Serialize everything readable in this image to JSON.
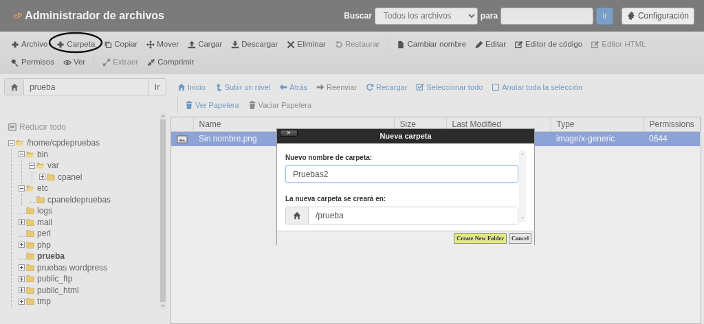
{
  "header": {
    "logo": "cP",
    "title": "Administrador de archivos",
    "search_label": "Buscar",
    "search_scope": "Todos los archivos",
    "for_label": "para",
    "go_button": "Ir",
    "settings_button": "Configuración"
  },
  "toolbar": {
    "rows": [
      {
        "groups": [
          {
            "items": [
              {
                "label": "Archivo",
                "disabled": false,
                "circled": false
              },
              {
                "label": "Carpeta",
                "disabled": false,
                "circled": true
              },
              {
                "label": "Copiar",
                "disabled": false,
                "circled": false
              },
              {
                "label": "Mover",
                "disabled": false,
                "circled": false
              },
              {
                "label": "Cargar",
                "disabled": false,
                "circled": false
              },
              {
                "label": "Descargar",
                "disabled": false,
                "circled": false
              },
              {
                "label": "Eliminar",
                "disabled": false,
                "circled": false
              },
              {
                "label": "Restaurar",
                "disabled": true,
                "circled": false
              }
            ]
          },
          {
            "items": [
              {
                "label": "Cambiar nombre",
                "disabled": false,
                "circled": false
              },
              {
                "label": "Editar",
                "disabled": false,
                "circled": false
              },
              {
                "label": "Editor de código",
                "disabled": false,
                "circled": false
              },
              {
                "label": "Editor HTML",
                "disabled": true,
                "circled": false
              }
            ]
          }
        ]
      },
      {
        "groups": [
          {
            "items": [
              {
                "label": "Permisos",
                "disabled": false,
                "circled": false
              },
              {
                "label": "Ver",
                "disabled": false,
                "circled": false
              }
            ]
          },
          {
            "items": [
              {
                "label": "Extraer",
                "disabled": true,
                "circled": false
              },
              {
                "label": "Comprimir",
                "disabled": false,
                "circled": false
              }
            ]
          }
        ]
      }
    ]
  },
  "path_bar": {
    "value": "prueba",
    "go_button": "Ir"
  },
  "tree": {
    "collapse_all": "Reducir todo",
    "nodes": [
      {
        "label": "/home/cpdepruebas",
        "kind": "branch",
        "expanded": true,
        "selected": false,
        "children": [
          {
            "label": "bin",
            "kind": "branch",
            "expanded": true,
            "selected": false,
            "children": [
              {
                "label": "var",
                "kind": "branch",
                "expanded": true,
                "selected": false,
                "children": [
                  {
                    "label": "cpanel",
                    "kind": "branch",
                    "expanded": false,
                    "selected": false
                  }
                ]
              }
            ]
          },
          {
            "label": "etc",
            "kind": "branch",
            "expanded": true,
            "selected": false,
            "children": [
              {
                "label": "cpaneldepruebas",
                "kind": "leaf",
                "selected": false
              }
            ]
          },
          {
            "label": "logs",
            "kind": "leaf",
            "selected": false
          },
          {
            "label": "mail",
            "kind": "branch",
            "expanded": false,
            "selected": false
          },
          {
            "label": "perl",
            "kind": "leaf",
            "selected": false
          },
          {
            "label": "php",
            "kind": "branch",
            "expanded": false,
            "selected": false
          },
          {
            "label": "prueba",
            "kind": "leaf",
            "selected": true
          },
          {
            "label": "pruebas wordpress",
            "kind": "branch",
            "expanded": false,
            "selected": false
          },
          {
            "label": "public_ftp",
            "kind": "branch",
            "expanded": false,
            "selected": false
          },
          {
            "label": "public_html",
            "kind": "branch",
            "expanded": false,
            "selected": false
          },
          {
            "label": "tmp",
            "kind": "branch",
            "expanded": false,
            "selected": false
          }
        ]
      }
    ]
  },
  "file_nav": {
    "groups": [
      [
        {
          "label": "Inicio",
          "disabled": false
        },
        {
          "label": "Subir un nivel",
          "disabled": false
        },
        {
          "label": "Atrás",
          "disabled": false
        },
        {
          "label": "Reenviar",
          "disabled": true
        },
        {
          "label": "Recargar",
          "disabled": false
        },
        {
          "label": "Seleccionar todo",
          "disabled": false
        },
        {
          "label": "Anular toda la selección",
          "disabled": false
        }
      ],
      [
        {
          "label": "Ver Papelera",
          "disabled": false
        },
        {
          "label": "Vaciar Papelera",
          "disabled": true
        }
      ]
    ]
  },
  "table": {
    "columns": [
      "Name",
      "Size",
      "Last Modified",
      "Type",
      "Permissions"
    ],
    "rows": [
      {
        "name": "Sin nombre.png",
        "type": "image/x-generic",
        "permissions": "0644",
        "selected": true
      }
    ]
  },
  "dialog": {
    "title": "Nueva carpeta",
    "close_label": "×",
    "name_label": "Nuevo nombre de carpeta:",
    "name_value": "Pruebas2",
    "location_label": "La nueva carpeta se creará en:",
    "location_value": "/prueba",
    "buttons": [
      {
        "label": "Create New Folder",
        "kind": "primary"
      },
      {
        "label": "Cancel",
        "kind": "secondary"
      }
    ]
  }
}
